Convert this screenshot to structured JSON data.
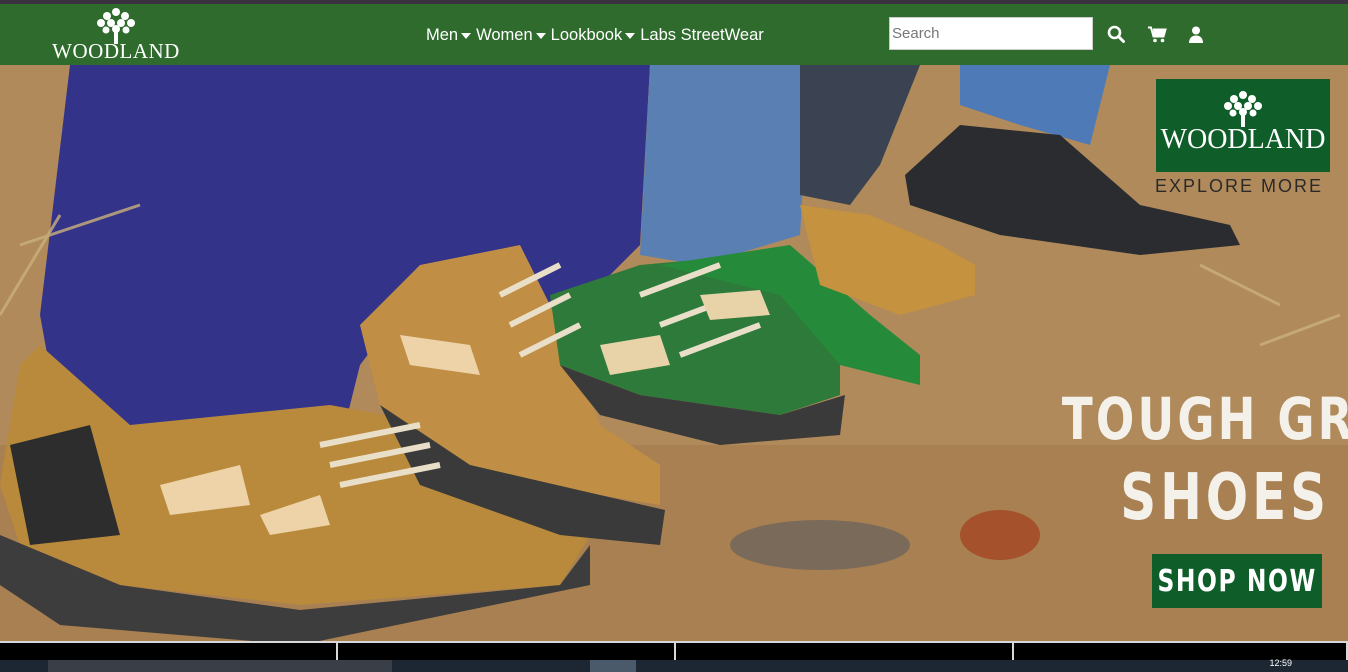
{
  "brand": {
    "name": "WOODLAND",
    "logo_icon": "tree-icon"
  },
  "nav": {
    "items": [
      {
        "label": "Men",
        "has_dropdown": true
      },
      {
        "label": "Women",
        "has_dropdown": true
      },
      {
        "label": "Lookbook",
        "has_dropdown": true
      },
      {
        "label": "Labs StreetWear",
        "has_dropdown": false
      }
    ]
  },
  "search": {
    "placeholder": "Search",
    "value": ""
  },
  "icons": {
    "search": "search-icon",
    "cart": "cart-icon",
    "account": "user-icon"
  },
  "hero": {
    "brand_box": "WOODLAND",
    "tagline": "EXPLORE MORE",
    "headline_line1": "TOUGH GRIP",
    "headline_line2": "SHOES",
    "cta": "SHOP NOW"
  },
  "taskbar": {
    "clock": "12:59"
  },
  "colors": {
    "nav_bg": "#2f6b2c",
    "brand_green": "#0f5e2a",
    "text_light": "#f4f1ea"
  }
}
